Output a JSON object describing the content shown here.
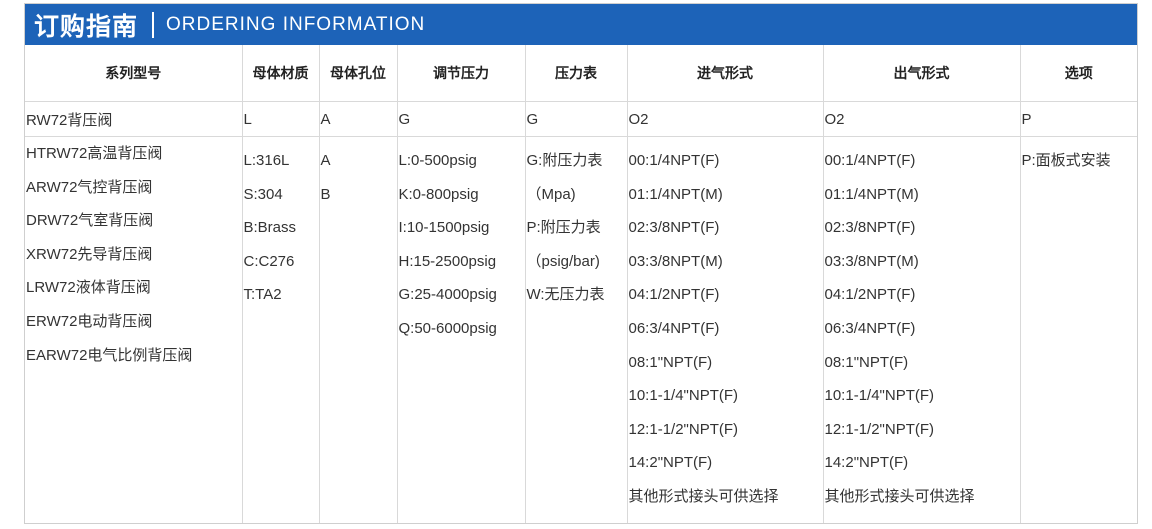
{
  "banner": {
    "title_cn": "订购指南",
    "title_en": "ORDERING INFORMATION"
  },
  "columns": [
    {
      "header": "系列型号",
      "code": "RW72背压阀"
    },
    {
      "header": "母体材质",
      "code": "L"
    },
    {
      "header": "母体孔位",
      "code": "A"
    },
    {
      "header": "调节压力",
      "code": "G"
    },
    {
      "header": "压力表",
      "code": "G"
    },
    {
      "header": "进气形式",
      "code": "O2"
    },
    {
      "header": "出气形式",
      "code": "O2"
    },
    {
      "header": "选项",
      "code": "P"
    }
  ],
  "options": {
    "series": [
      "HTRW72高温背压阀",
      "ARW72气控背压阀",
      "DRW72气室背压阀",
      "XRW72先导背压阀",
      "LRW72液体背压阀",
      "ERW72电动背压阀",
      "EARW72电气比例背压阀"
    ],
    "material": [
      "L:316L",
      "S:304",
      "B:Brass",
      "C:C276",
      "T:TA2"
    ],
    "port": [
      "A",
      "B"
    ],
    "pressure": [
      "L:0-500psig",
      "K:0-800psig",
      "I:10-1500psig",
      "H:15-2500psig",
      "G:25-4000psig",
      "Q:50-6000psig"
    ],
    "gauge": [
      "G:附压力表",
      "（Mpa)",
      "P:附压力表",
      "（psig/bar)",
      "W:无压力表"
    ],
    "inlet": [
      "00:1/4NPT(F)",
      "01:1/4NPT(M)",
      "02:3/8NPT(F)",
      "03:3/8NPT(M)",
      "04:1/2NPT(F)",
      "06:3/4NPT(F)",
      "08:1\"NPT(F)",
      "10:1-1/4\"NPT(F)",
      "12:1-1/2\"NPT(F)",
      "14:2\"NPT(F)",
      "其他形式接头可供选择"
    ],
    "outlet": [
      "00:1/4NPT(F)",
      "01:1/4NPT(M)",
      "02:3/8NPT(F)",
      "03:3/8NPT(M)",
      "04:1/2NPT(F)",
      "06:3/4NPT(F)",
      "08:1\"NPT(F)",
      "10:1-1/4\"NPT(F)",
      "12:1-1/2\"NPT(F)",
      "14:2\"NPT(F)",
      "其他形式接头可供选择"
    ],
    "extra": [
      "P:面板式安装"
    ]
  }
}
